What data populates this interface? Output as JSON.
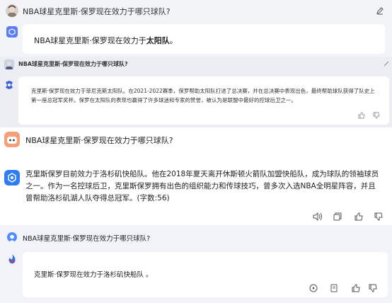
{
  "section1": {
    "question": "NBA球星克里斯·保罗现在效力于哪只球队?",
    "answer_prefix": "NBA球星克里斯·保罗现在效力于",
    "answer_bold": "太阳队",
    "answer_suffix": "。"
  },
  "section2": {
    "question": "NBA球星克里斯·保罗现在效力于哪只球队?",
    "answer": "克里斯·保罗现在效力于菲尼克斯太阳队。在2021-2022赛季，保罗帮助太阳队打进了总决赛，并在总决赛中表现出色，最终帮助球队获得了队史上第一座总冠军奖杯。保罗在太阳队的表现也赢得了许多球迷和专家的赞誉，被认为是联盟中最好的控球后卫之一。"
  },
  "section3": {
    "question": "NBA球星克里斯·保罗现在效力于哪只球队?",
    "answer": "克里斯保罗目前效力于洛杉矶快船队。他在2018年夏天离开休斯顿火箭队加盟快船队，成为球队的领袖球员之一。作为一名控球后卫，克里斯保罗拥有出色的组织能力和传球技巧，曾多次入选NBA全明星阵容，并且曾帮助洛杉矶湖人队夺得总冠军。(字数:56)"
  },
  "section4": {
    "question": "NBA球星克里斯·保罗现在效力于哪只球队?",
    "answer": "克里斯·保罗现在效力于洛杉矶快船队 。"
  },
  "colors": {
    "page_bg": "#eef0f5",
    "bubble_bg": "#ffffff",
    "accent_blue": "#4f8cff",
    "logo_purple": "#5b7cf7"
  }
}
